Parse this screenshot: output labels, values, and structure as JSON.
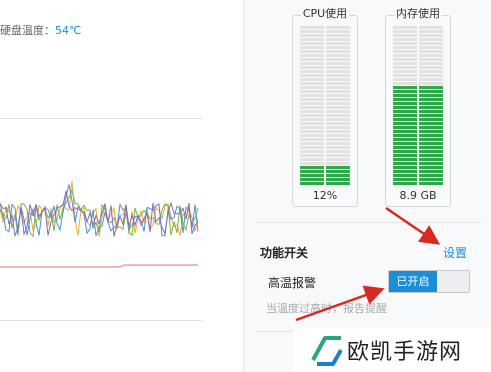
{
  "left_panel": {
    "disk_temp_label": "硬盘温度：",
    "disk_temp_value": "54℃"
  },
  "meters": [
    {
      "title": "CPU使用",
      "value_text": "12%",
      "fill_fraction": 0.12
    },
    {
      "title": "内存使用",
      "value_text": "8.9 GB",
      "fill_fraction": 0.62
    }
  ],
  "function_section": {
    "title": "功能开关",
    "settings_link": "设置",
    "alarm_label": "高温报警",
    "toggle_on_text": "已开启",
    "alarm_desc": "当温度过高时，报告提醒"
  },
  "watermark": {
    "text": "欧凯手游网"
  },
  "colors": {
    "accent": "#1a8fd8",
    "meter_fill": "#2ea84a",
    "meter_empty": "#e2e2e2",
    "alarm_line": "#f08a8a",
    "annotation_arrow": "#d9281f"
  }
}
